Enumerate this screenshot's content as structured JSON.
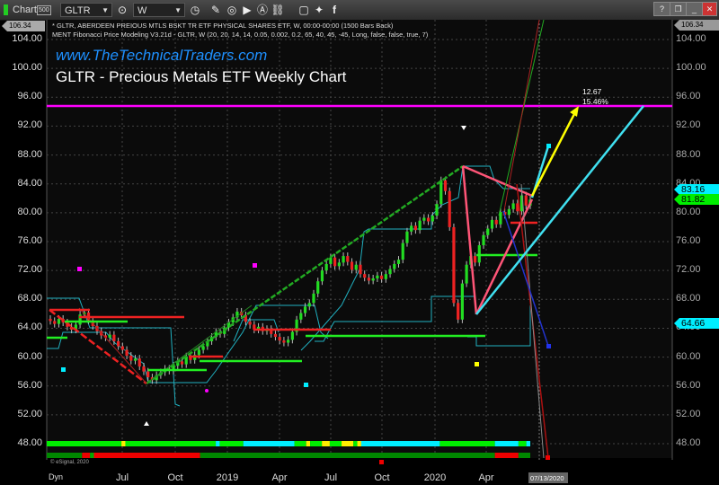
{
  "toolbar": {
    "app_label": "Chart",
    "badge": "500",
    "symbol": "GLTR",
    "interval": "W",
    "window_buttons": [
      "?",
      "restore",
      "minimize",
      "maximize",
      "close"
    ]
  },
  "legend": {
    "line1": "* GLTR, ABERDEEN PREIOUS MTLS BSKT TR ETF PHYSICAL SHARES ETF, W, 00:00-00:00 (1500 Bars Back)",
    "line2": "MENT Fibonacci Price Modeling V3.21d - GLTR, W (20, 20, 14, 14, 0.05, 0.002, 0.2, 65, 40, 45, -45, Long, false, false, true, 7)"
  },
  "overlay": {
    "site": "www.TheTechnicalTraders.com",
    "title": "GLTR - Precious Metals ETF Weekly Chart"
  },
  "annotation": {
    "points": "12.67",
    "percent": "15.46%"
  },
  "price_tags": {
    "top": "106.34",
    "last_cyan": "83.16",
    "last_green": "81.82",
    "lower_cyan": "64.66"
  },
  "copyright": "© eSignal, 2020",
  "x_footer": {
    "dyn": "Dyn",
    "current_date": "07/13/2020"
  },
  "colors": {
    "up": "#22dd22",
    "down": "#ee2222",
    "target": "#ff00ff",
    "channel": "#20b0c0",
    "arrow": "#ffff00",
    "projection": "#40e0f0"
  },
  "chart_data": {
    "type": "candlestick",
    "title": "GLTR - Precious Metals ETF Weekly Chart",
    "y_ticks": [
      "104.00",
      "100.00",
      "96.00",
      "92.00",
      "88.00",
      "84.00",
      "80.00",
      "76.00",
      "72.00",
      "68.00",
      "64.00",
      "60.00",
      "56.00",
      "52.00",
      "48.00"
    ],
    "ylim": [
      48,
      104
    ],
    "x_ticks": [
      "Jul",
      "Oct",
      "2019",
      "Apr",
      "Jul",
      "Oct",
      "2020",
      "Apr"
    ],
    "target_level": 94.6,
    "weekly_close": [
      65.0,
      64.6,
      65.3,
      64.8,
      64.2,
      63.8,
      64.5,
      65.9,
      66.2,
      65.1,
      64.3,
      63.6,
      63.0,
      62.7,
      63.1,
      62.2,
      61.5,
      61.0,
      60.2,
      59.5,
      59.8,
      58.7,
      58.0,
      57.2,
      56.8,
      57.5,
      57.9,
      58.4,
      58.1,
      58.8,
      59.4,
      59.0,
      60.1,
      59.6,
      60.3,
      61.0,
      61.5,
      62.2,
      62.8,
      63.5,
      63.2,
      64.1,
      64.8,
      65.5,
      66.3,
      65.8,
      64.9,
      64.5,
      63.8,
      64.2,
      63.6,
      63.9,
      63.2,
      62.8,
      62.3,
      62.0,
      62.4,
      63.5,
      65.2,
      66.1,
      67.0,
      67.5,
      68.8,
      70.5,
      72.0,
      72.9,
      73.8,
      72.6,
      73.1,
      74.0,
      73.2,
      72.1,
      72.8,
      71.5,
      71.0,
      70.6,
      70.9,
      71.3,
      70.8,
      71.5,
      72.2,
      72.9,
      73.5,
      75.8,
      77.4,
      78.2,
      77.6,
      78.9,
      79.3,
      78.8,
      79.6,
      81.2,
      84.5,
      83.0,
      78.0,
      67.5,
      65.2,
      70.2,
      72.8,
      74.0,
      73.1,
      75.5,
      76.9,
      77.8,
      79.0,
      78.4,
      80.1,
      79.7,
      80.5,
      81.3,
      80.2,
      82.4,
      81.0,
      81.82
    ],
    "indicator_row1": [
      [
        "#00ee00",
        19
      ],
      [
        "#ffee00",
        1
      ],
      [
        "#00ee00",
        23
      ],
      [
        "#00eeff",
        1
      ],
      [
        "#00ee00",
        6
      ],
      [
        "#00eeff",
        13
      ],
      [
        "#00ee00",
        3
      ],
      [
        "#ffee00",
        1
      ],
      [
        "#00ee00",
        3
      ],
      [
        "#ffee00",
        2
      ],
      [
        "#00ee00",
        3
      ],
      [
        "#ffee00",
        3
      ],
      [
        "#00ee00",
        1
      ],
      [
        "#ffee00",
        1
      ],
      [
        "#00eeff",
        20
      ],
      [
        "#00ee00",
        14
      ],
      [
        "#00eeff",
        6
      ],
      [
        "#00ee00",
        2
      ],
      [
        "#00eeff",
        1
      ]
    ],
    "indicator_row2": [
      [
        "#008800",
        9
      ],
      [
        "#ee0000",
        2
      ],
      [
        "#00aa00",
        1
      ],
      [
        "#ee0000",
        27
      ],
      [
        "#008800",
        75
      ],
      [
        "#ee0000",
        6
      ],
      [
        "#008800",
        3
      ]
    ]
  }
}
